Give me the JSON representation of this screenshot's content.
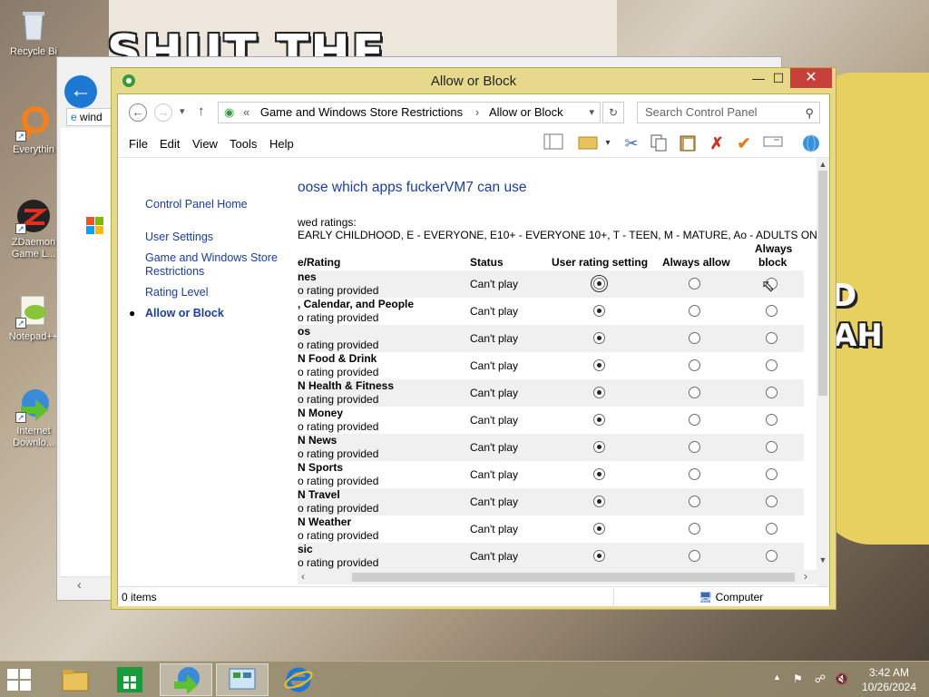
{
  "desktop": {
    "wall_text": "SHUT THE",
    "wall_text_right": "AH",
    "wall_text_d": "D",
    "icons": [
      {
        "label": "Recycle Bi",
        "icon": "recycle-bin-icon"
      },
      {
        "label": "Everythin",
        "icon": "everything-search-icon"
      },
      {
        "label": "ZDaemon Game L...",
        "icon": "zdaemon-icon"
      },
      {
        "label": "Notepad++",
        "icon": "notepad-plus-plus-icon"
      },
      {
        "label": "Internet Downlo...",
        "icon": "internet-download-manager-icon"
      }
    ]
  },
  "bg_window": {
    "tab_label": "wind"
  },
  "window": {
    "title": "Allow or Block",
    "controls": {
      "minimize": "—",
      "maximize": "☐",
      "close": "✕"
    },
    "nav": {
      "back": "←",
      "forward": "→",
      "up": "↑",
      "dropdown": "▾",
      "breadcrumb_prefix": "«",
      "breadcrumbs": [
        "Game and Windows Store Restrictions",
        "Allow or Block"
      ],
      "breadcrumb_sep": "›",
      "refresh": "↻",
      "search_placeholder": "Search Control Panel"
    },
    "menu": [
      "File",
      "Edit",
      "View",
      "Tools",
      "Help"
    ],
    "left_pane": {
      "home": "Control Panel Home",
      "user_settings": "User Settings",
      "game_restrictions": "Game and Windows Store Restrictions",
      "rating_level": "Rating Level",
      "allow_block": "Allow or Block",
      "bullet": "●"
    },
    "content": {
      "heading": "oose which apps fuckerVM7 can use",
      "allowed_label": "wed ratings:",
      "ratings": "EARLY CHILDHOOD, E - EVERYONE, E10+ - EVERYONE 10+, T - TEEN, M - MATURE, Ao - ADULTS ONLY",
      "columns": {
        "name": "e/Rating",
        "status": "Status",
        "user_rating": "User rating setting",
        "always_allow": "Always allow",
        "always_block_1": "Always",
        "always_block_2": "block"
      },
      "rows": [
        {
          "name": "nes",
          "sub": "o rating provided",
          "status": "Can't play",
          "selected": "user"
        },
        {
          "name": ", Calendar, and People",
          "sub": "o rating provided",
          "status": "Can't play",
          "selected": "user"
        },
        {
          "name": "os",
          "sub": "o rating provided",
          "status": "Can't play",
          "selected": "user"
        },
        {
          "name": "N Food & Drink",
          "sub": "o rating provided",
          "status": "Can't play",
          "selected": "user"
        },
        {
          "name": "N Health & Fitness",
          "sub": "o rating provided",
          "status": "Can't play",
          "selected": "user"
        },
        {
          "name": "N Money",
          "sub": "o rating provided",
          "status": "Can't play",
          "selected": "user"
        },
        {
          "name": "N News",
          "sub": "o rating provided",
          "status": "Can't play",
          "selected": "user"
        },
        {
          "name": "N Sports",
          "sub": "o rating provided",
          "status": "Can't play",
          "selected": "user"
        },
        {
          "name": "N Travel",
          "sub": "o rating provided",
          "status": "Can't play",
          "selected": "user"
        },
        {
          "name": "N Weather",
          "sub": "o rating provided",
          "status": "Can't play",
          "selected": "user"
        },
        {
          "name": "sic",
          "sub": "o rating provided",
          "status": "Can't play",
          "selected": "user"
        }
      ]
    },
    "statusbar": {
      "items": "0 items",
      "location": "Computer"
    }
  },
  "taskbar": {
    "apps": [
      "file-explorer-icon",
      "windows-store-icon",
      "internet-download-manager-icon",
      "control-panel-icon",
      "internet-explorer-icon"
    ],
    "clock_time": "3:42 AM",
    "clock_date": "10/26/2024"
  },
  "colors": {
    "window_frame": "#e6d98c",
    "close_button": "#c7403a",
    "link": "#1b3e9b"
  }
}
